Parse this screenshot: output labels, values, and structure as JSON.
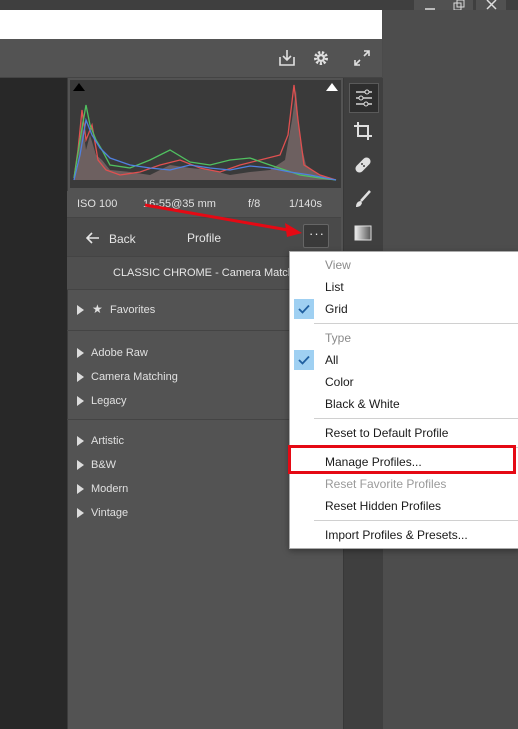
{
  "window": {
    "minimize_icon": "minimize-icon",
    "restore_icon": "restore-icon",
    "close_icon": "close-icon"
  },
  "toolbar": {
    "export_icon": "export-icon",
    "settings_icon": "gear-icon",
    "expand_icon": "expand-icon"
  },
  "exif": {
    "iso": "ISO 100",
    "lens": "16-55@35 mm",
    "aperture": "f/8",
    "shutter": "1/140s"
  },
  "header": {
    "back_label": "Back",
    "title": "Profile",
    "more_label": "···"
  },
  "current_profile": "CLASSIC CHROME - Camera Matching",
  "groups": [
    {
      "items": [
        {
          "label": "Favorites",
          "star": true
        }
      ]
    },
    {
      "items": [
        {
          "label": "Adobe Raw"
        },
        {
          "label": "Camera Matching"
        },
        {
          "label": "Legacy"
        }
      ]
    },
    {
      "items": [
        {
          "label": "Artistic"
        },
        {
          "label": "B&W"
        },
        {
          "label": "Modern"
        },
        {
          "label": "Vintage"
        }
      ]
    }
  ],
  "tools": [
    "edit-sliders-icon",
    "crop-icon",
    "healing-icon",
    "brush-icon",
    "gradient-icon"
  ],
  "menu": {
    "view_header": "View",
    "view_list": "List",
    "view_grid": "Grid",
    "type_header": "Type",
    "type_all": "All",
    "type_color": "Color",
    "type_bw": "Black & White",
    "reset_default": "Reset to Default Profile",
    "manage_profiles": "Manage Profiles...",
    "reset_favorites": "Reset Favorite Profiles",
    "reset_hidden": "Reset Hidden Profiles",
    "import": "Import Profiles & Presets..."
  },
  "colors": {
    "annotation_red": "#e50914",
    "check_highlight": "#9fd0f2"
  }
}
